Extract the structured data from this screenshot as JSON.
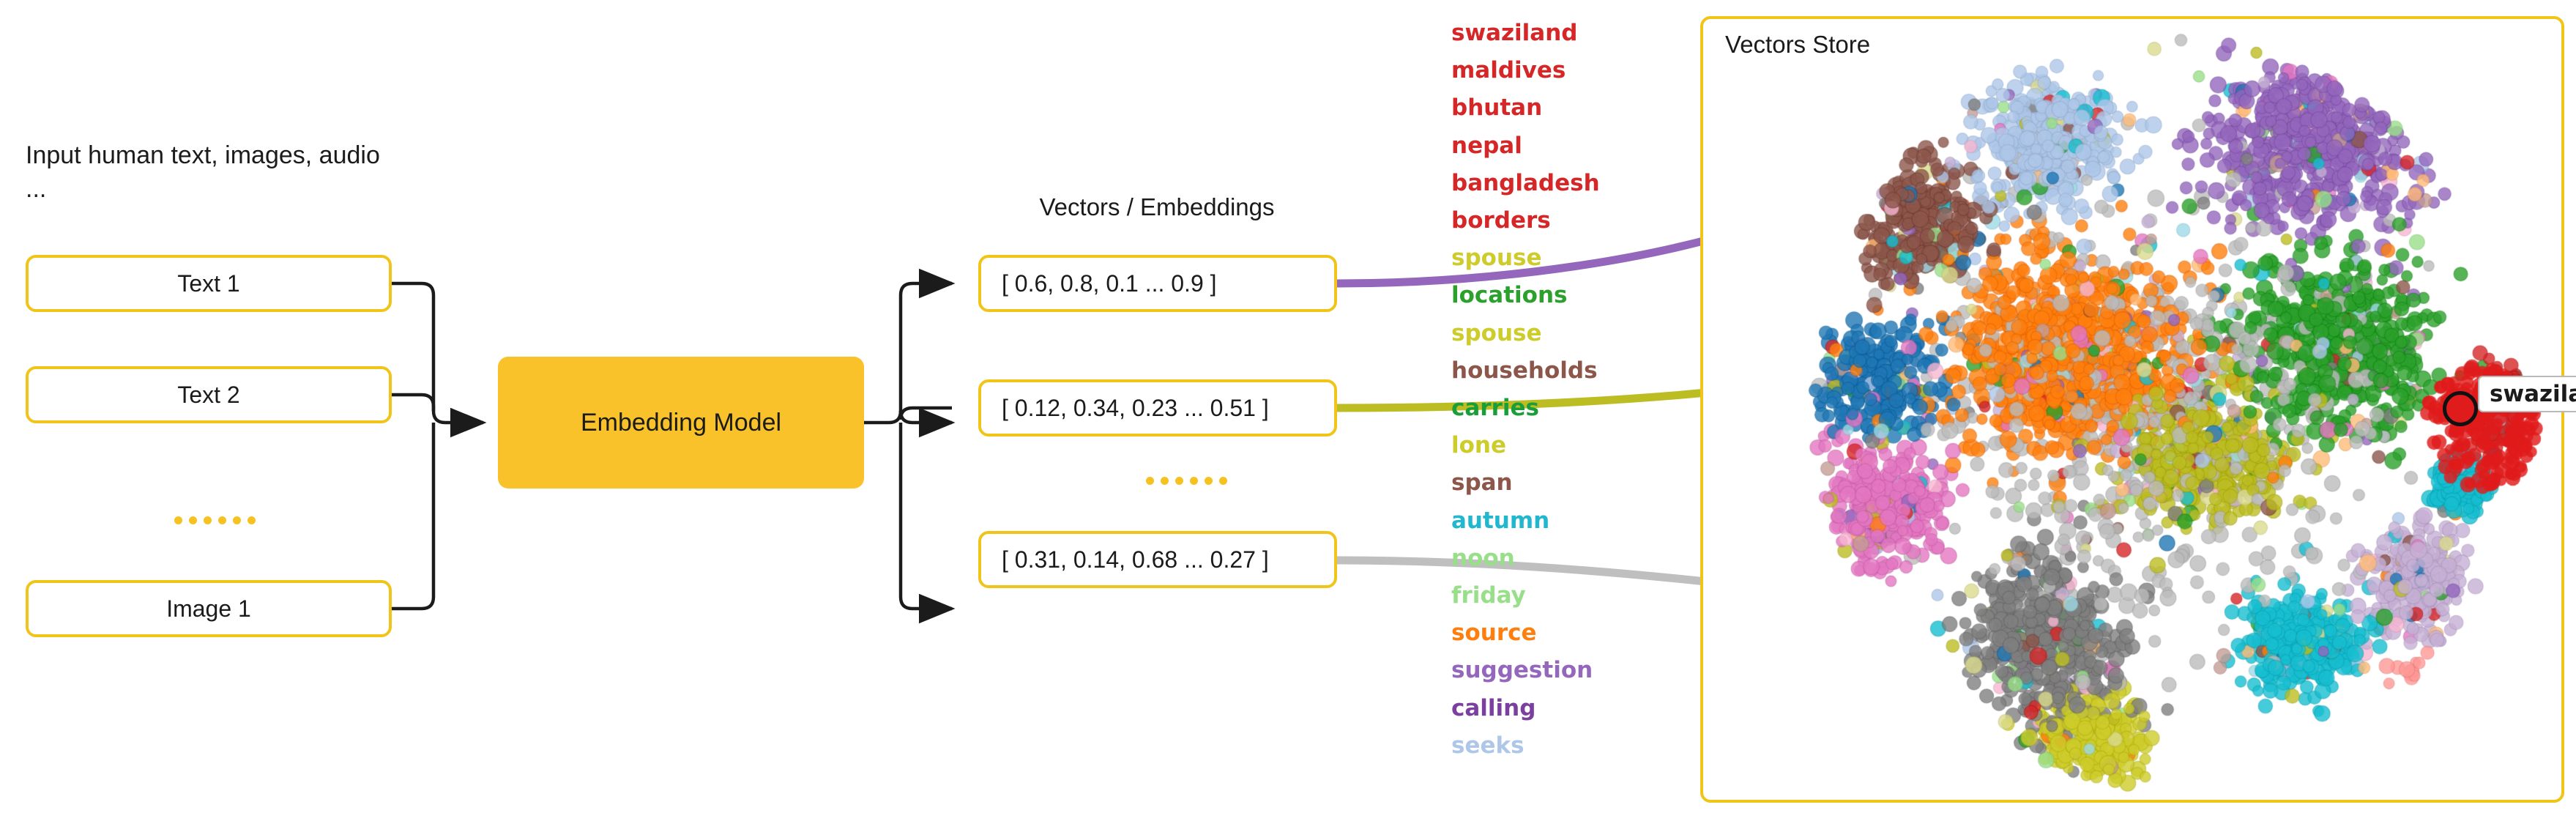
{
  "input": {
    "caption": "Input human text, images, audio ...",
    "boxes": [
      {
        "label": "Text 1"
      },
      {
        "label": "Text 2"
      },
      {
        "label": "Image 1"
      }
    ],
    "ellipsis_dot_count": 6
  },
  "model": {
    "label": "Embedding Model",
    "fill_color": "#f9c22b"
  },
  "vectors": {
    "title": "Vectors / Embeddings",
    "boxes": [
      {
        "label": "[ 0.6, 0.8, 0.1 ... 0.9 ]",
        "connector_color": "#9467bd"
      },
      {
        "label": "[ 0.12, 0.34, 0.23 ... 0.51 ]",
        "connector_color": "#bcbd22"
      },
      {
        "label": "[ 0.31, 0.14, 0.68 ... 0.27 ]",
        "connector_color": "#bfbfbf"
      }
    ],
    "ellipsis_dot_count": 6
  },
  "word_list": [
    {
      "text": "swaziland",
      "color": "#d62728"
    },
    {
      "text": "maldives",
      "color": "#d62728"
    },
    {
      "text": "bhutan",
      "color": "#d62728"
    },
    {
      "text": "nepal",
      "color": "#d62728"
    },
    {
      "text": "bangladesh",
      "color": "#d62728"
    },
    {
      "text": "borders",
      "color": "#d62728"
    },
    {
      "text": "spouse",
      "color": "#cdcc2a"
    },
    {
      "text": "locations",
      "color": "#2ca02c"
    },
    {
      "text": "spouse",
      "color": "#cdcc2a"
    },
    {
      "text": "households",
      "color": "#8c564b"
    },
    {
      "text": "carries",
      "color": "#1a9e3a"
    },
    {
      "text": "lone",
      "color": "#cdcc2a"
    },
    {
      "text": "span",
      "color": "#8c564b"
    },
    {
      "text": "autumn",
      "color": "#21b7cf"
    },
    {
      "text": "noon",
      "color": "#98df8a"
    },
    {
      "text": "friday",
      "color": "#98df8a"
    },
    {
      "text": "source",
      "color": "#ff7f0e"
    },
    {
      "text": "suggestion",
      "color": "#9467bd"
    },
    {
      "text": "calling",
      "color": "#7b3fa0"
    },
    {
      "text": "seeks",
      "color": "#aec7e8"
    }
  ],
  "vectors_store": {
    "title": "Vectors Store",
    "border_color": "#f0c419",
    "highlight": {
      "label": "swaziland",
      "point_color": "#e01b1b"
    }
  },
  "chart_data": {
    "type": "scatter",
    "title": "Vectors Store",
    "xlabel": "",
    "ylabel": "",
    "grid": false,
    "legend": "none",
    "description": "Dense 2-D projection (t-SNE/UMAP style) of word embeddings; thousands of semi-transparent colored markers form topic clusters.",
    "highlighted_point": {
      "label": "swaziland",
      "color": "#e01b1b"
    },
    "cluster_colors": [
      "#9467bd",
      "#ff7f0e",
      "#aec7e8",
      "#8c564b",
      "#2ca02c",
      "#1f77b4",
      "#bcbd22",
      "#d62728",
      "#e377c2",
      "#7f7f7f",
      "#17becf",
      "#98df8a",
      "#c5b0d5",
      "#ffbb78",
      "#f7b6d2",
      "#c49c94",
      "#dbdb8d",
      "#9edae5"
    ],
    "clusters": [
      {
        "name": "purple-top-right",
        "color": "#9467bd",
        "cx": 0.72,
        "cy": 0.16,
        "rx": 0.16,
        "ry": 0.13,
        "n": 620
      },
      {
        "name": "lightblue-top",
        "color": "#aec7e8",
        "cx": 0.4,
        "cy": 0.16,
        "rx": 0.11,
        "ry": 0.09,
        "n": 380
      },
      {
        "name": "brown-upper-left",
        "color": "#8c564b",
        "cx": 0.25,
        "cy": 0.26,
        "rx": 0.09,
        "ry": 0.1,
        "n": 300
      },
      {
        "name": "orange-core",
        "color": "#ff7f0e",
        "cx": 0.43,
        "cy": 0.43,
        "rx": 0.17,
        "ry": 0.15,
        "n": 900
      },
      {
        "name": "green-right",
        "color": "#2ca02c",
        "cx": 0.74,
        "cy": 0.42,
        "rx": 0.14,
        "ry": 0.13,
        "n": 560
      },
      {
        "name": "olive-center",
        "color": "#bcbd22",
        "cx": 0.58,
        "cy": 0.56,
        "rx": 0.11,
        "ry": 0.1,
        "n": 430
      },
      {
        "name": "blue-left",
        "color": "#1f77b4",
        "cx": 0.2,
        "cy": 0.46,
        "rx": 0.08,
        "ry": 0.08,
        "n": 260
      },
      {
        "name": "pink-lower-left",
        "color": "#e377c2",
        "cx": 0.21,
        "cy": 0.62,
        "rx": 0.09,
        "ry": 0.09,
        "n": 320
      },
      {
        "name": "grey-bottom",
        "color": "#7f7f7f",
        "cx": 0.4,
        "cy": 0.8,
        "rx": 0.11,
        "ry": 0.12,
        "n": 520
      },
      {
        "name": "darkolive-bottom",
        "color": "#cdcc2a",
        "cx": 0.45,
        "cy": 0.92,
        "rx": 0.08,
        "ry": 0.06,
        "n": 230
      },
      {
        "name": "cyan-bottom-right",
        "color": "#17becf",
        "cx": 0.7,
        "cy": 0.8,
        "rx": 0.09,
        "ry": 0.07,
        "n": 300
      },
      {
        "name": "lightpurple-right",
        "color": "#c5b0d5",
        "cx": 0.83,
        "cy": 0.72,
        "rx": 0.07,
        "ry": 0.08,
        "n": 240
      },
      {
        "name": "red-far-right",
        "color": "#d62728",
        "cx": 0.93,
        "cy": 0.5,
        "rx": 0.05,
        "ry": 0.07,
        "n": 230
      },
      {
        "name": "teal-right-edge",
        "color": "#17becf",
        "cx": 0.88,
        "cy": 0.6,
        "rx": 0.04,
        "ry": 0.05,
        "n": 110
      },
      {
        "name": "salmon-right",
        "color": "#ff9896",
        "cx": 0.86,
        "cy": 0.86,
        "rx": 0.06,
        "ry": 0.05,
        "n": 150
      },
      {
        "name": "scatter-halo",
        "color": "#bbbbbb",
        "cx": 0.52,
        "cy": 0.5,
        "rx": 0.3,
        "ry": 0.33,
        "n": 600
      }
    ]
  }
}
